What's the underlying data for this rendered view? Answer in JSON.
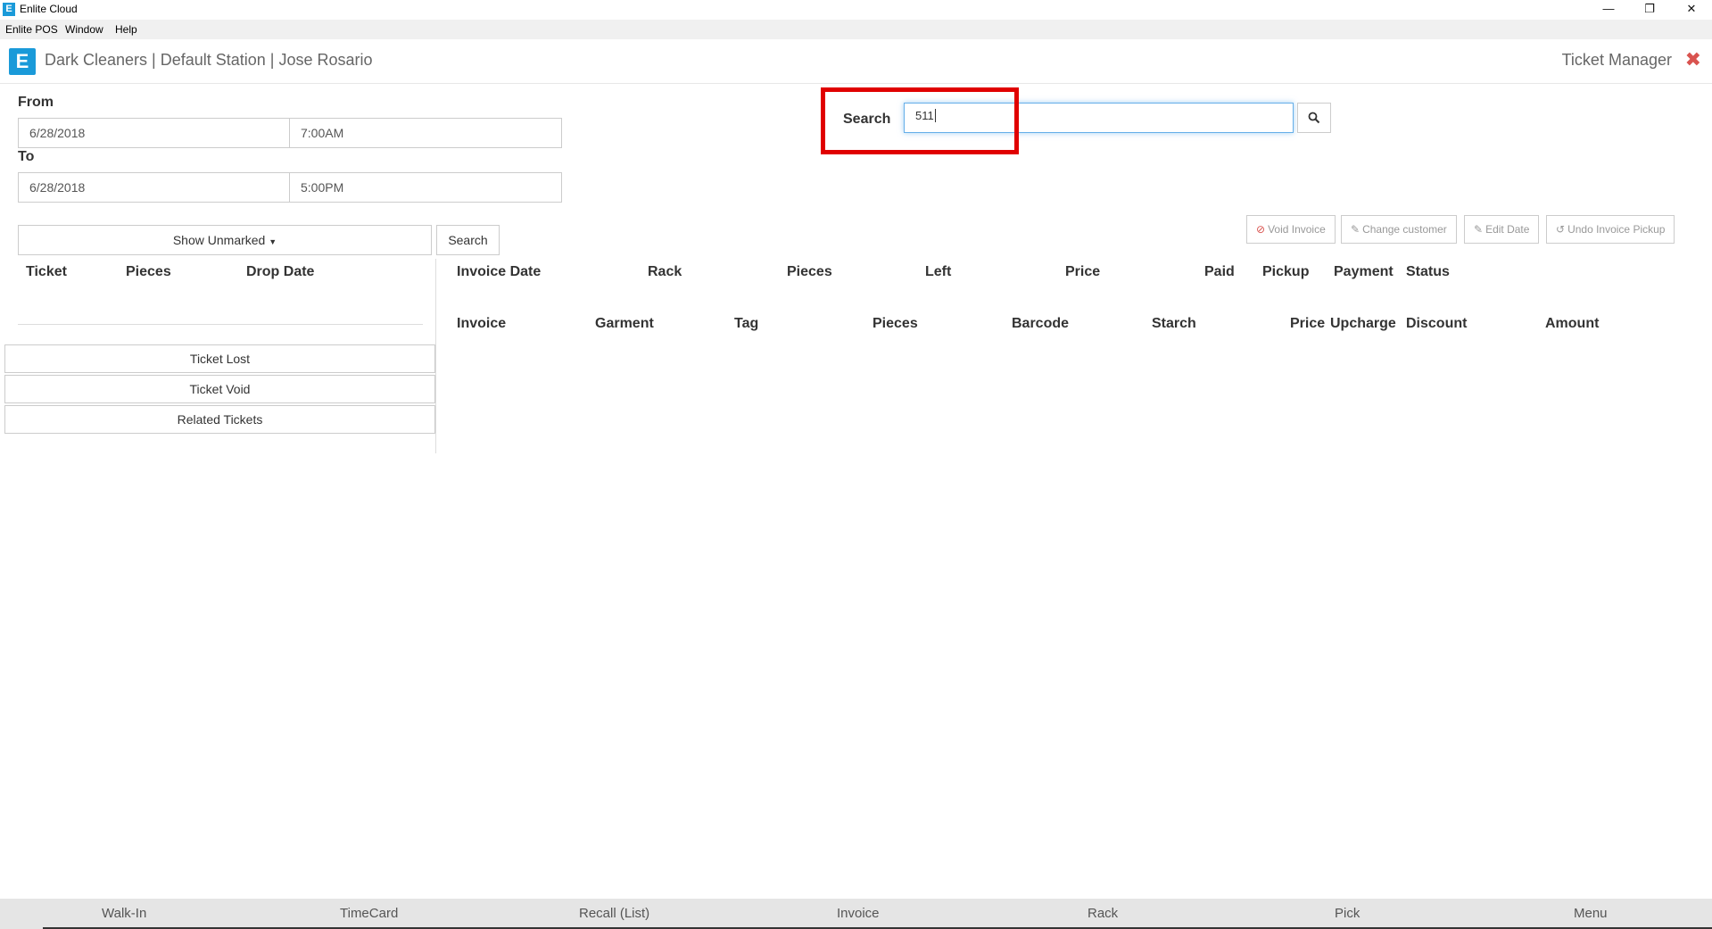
{
  "window": {
    "title": "Enlite Cloud",
    "app_icon_letter": "E"
  },
  "menubar": {
    "items": [
      "Enlite POS",
      "Window",
      "Help"
    ]
  },
  "header": {
    "logo_letter": "E",
    "breadcrumb": "Dark Cleaners | Default Station | Jose Rosario",
    "module_title": "Ticket Manager"
  },
  "filters": {
    "from_label": "From",
    "from_date": "6/28/2018",
    "from_time": "7:00AM",
    "to_label": "To",
    "to_date": "6/28/2018",
    "to_time": "5:00PM",
    "show_unmarked": "Show Unmarked",
    "search_button": "Search"
  },
  "search": {
    "label": "Search",
    "value": "511"
  },
  "actions": {
    "void_invoice": "Void Invoice",
    "change_customer": "Change customer",
    "edit_date": "Edit Date",
    "undo_pickup": "Undo Invoice Pickup"
  },
  "ticket_table": {
    "headers": [
      "Ticket",
      "Pieces",
      "Drop Date"
    ]
  },
  "ticket_actions": [
    "Ticket Lost",
    "Ticket Void",
    "Related Tickets"
  ],
  "invoice_table": {
    "headers": [
      "Invoice Date",
      "Rack",
      "Pieces",
      "Left",
      "Price",
      "Paid",
      "Pickup",
      "Payment",
      "Status"
    ]
  },
  "garment_table": {
    "headers": [
      "Invoice",
      "Garment",
      "Tag",
      "Pieces",
      "Barcode",
      "Starch",
      "Price",
      "Upcharge",
      "Discount",
      "Amount"
    ]
  },
  "bottom_nav": [
    "Walk-In",
    "TimeCard",
    "Recall (List)",
    "Invoice",
    "Rack",
    "Pick",
    "Menu"
  ],
  "colors": {
    "brand": "#1a9ad9",
    "highlight": "#e00000",
    "close": "#d9534f"
  }
}
